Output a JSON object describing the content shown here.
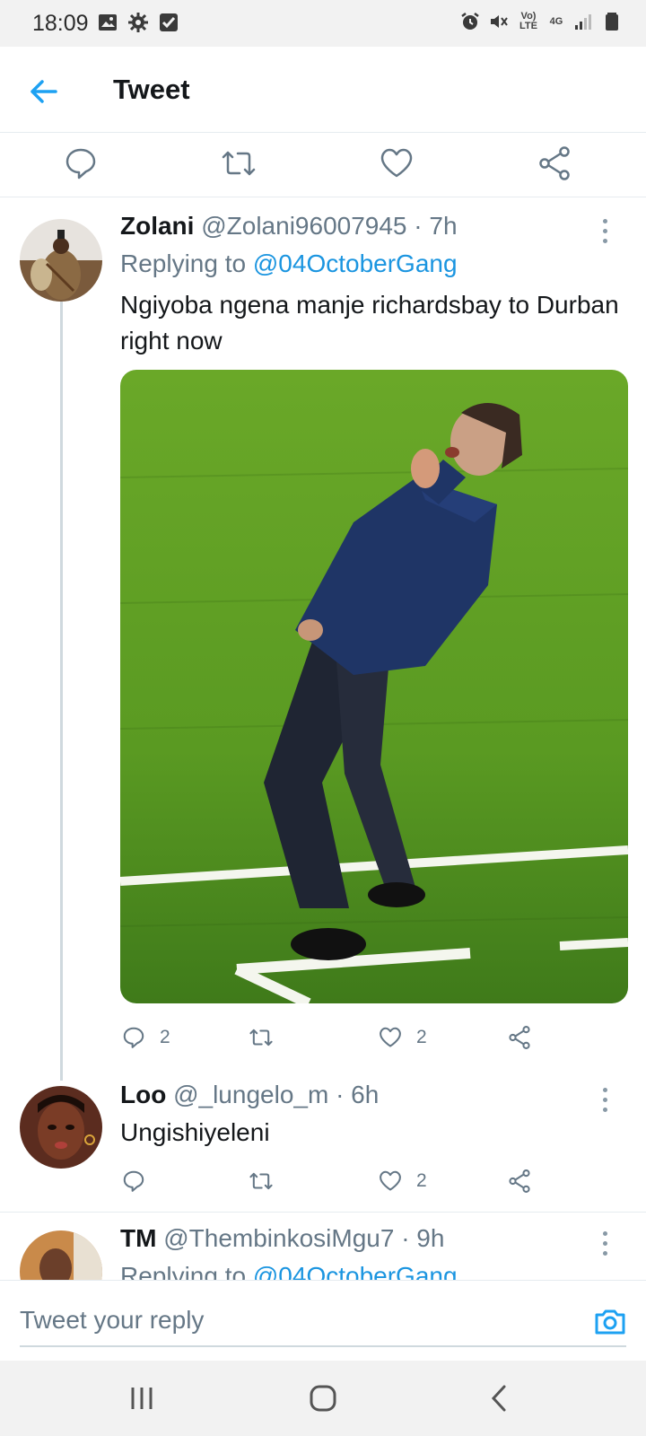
{
  "status_bar": {
    "time": "18:09",
    "lte_label": "Vo) LTE",
    "net_label": "4G"
  },
  "header": {
    "title": "Tweet"
  },
  "tweets": [
    {
      "name": "Zolani",
      "handle": "@Zolani96007945",
      "time": "· 7h",
      "replying_prefix": "Replying to ",
      "replying_to": "@04OctoberGang",
      "text": "Ngiyoba  ngena  manje richardsbay to Durban right now",
      "reply_count": "2",
      "retweet_count": "",
      "like_count": "2"
    },
    {
      "name": "Loo",
      "handle": "@_lungelo_m",
      "time": "· 6h",
      "text": "Ungishiyeleni",
      "reply_count": "",
      "retweet_count": "",
      "like_count": "2"
    },
    {
      "name": "TM",
      "handle": "@ThembinkosiMgu7",
      "time": "· 9h",
      "replying_prefix": "Replying to ",
      "replying_to": "@04OctoberGang"
    }
  ],
  "reply_bar": {
    "placeholder": "Tweet your reply"
  },
  "colors": {
    "accent": "#1da1f2",
    "text": "#14171a",
    "muted": "#657786"
  }
}
